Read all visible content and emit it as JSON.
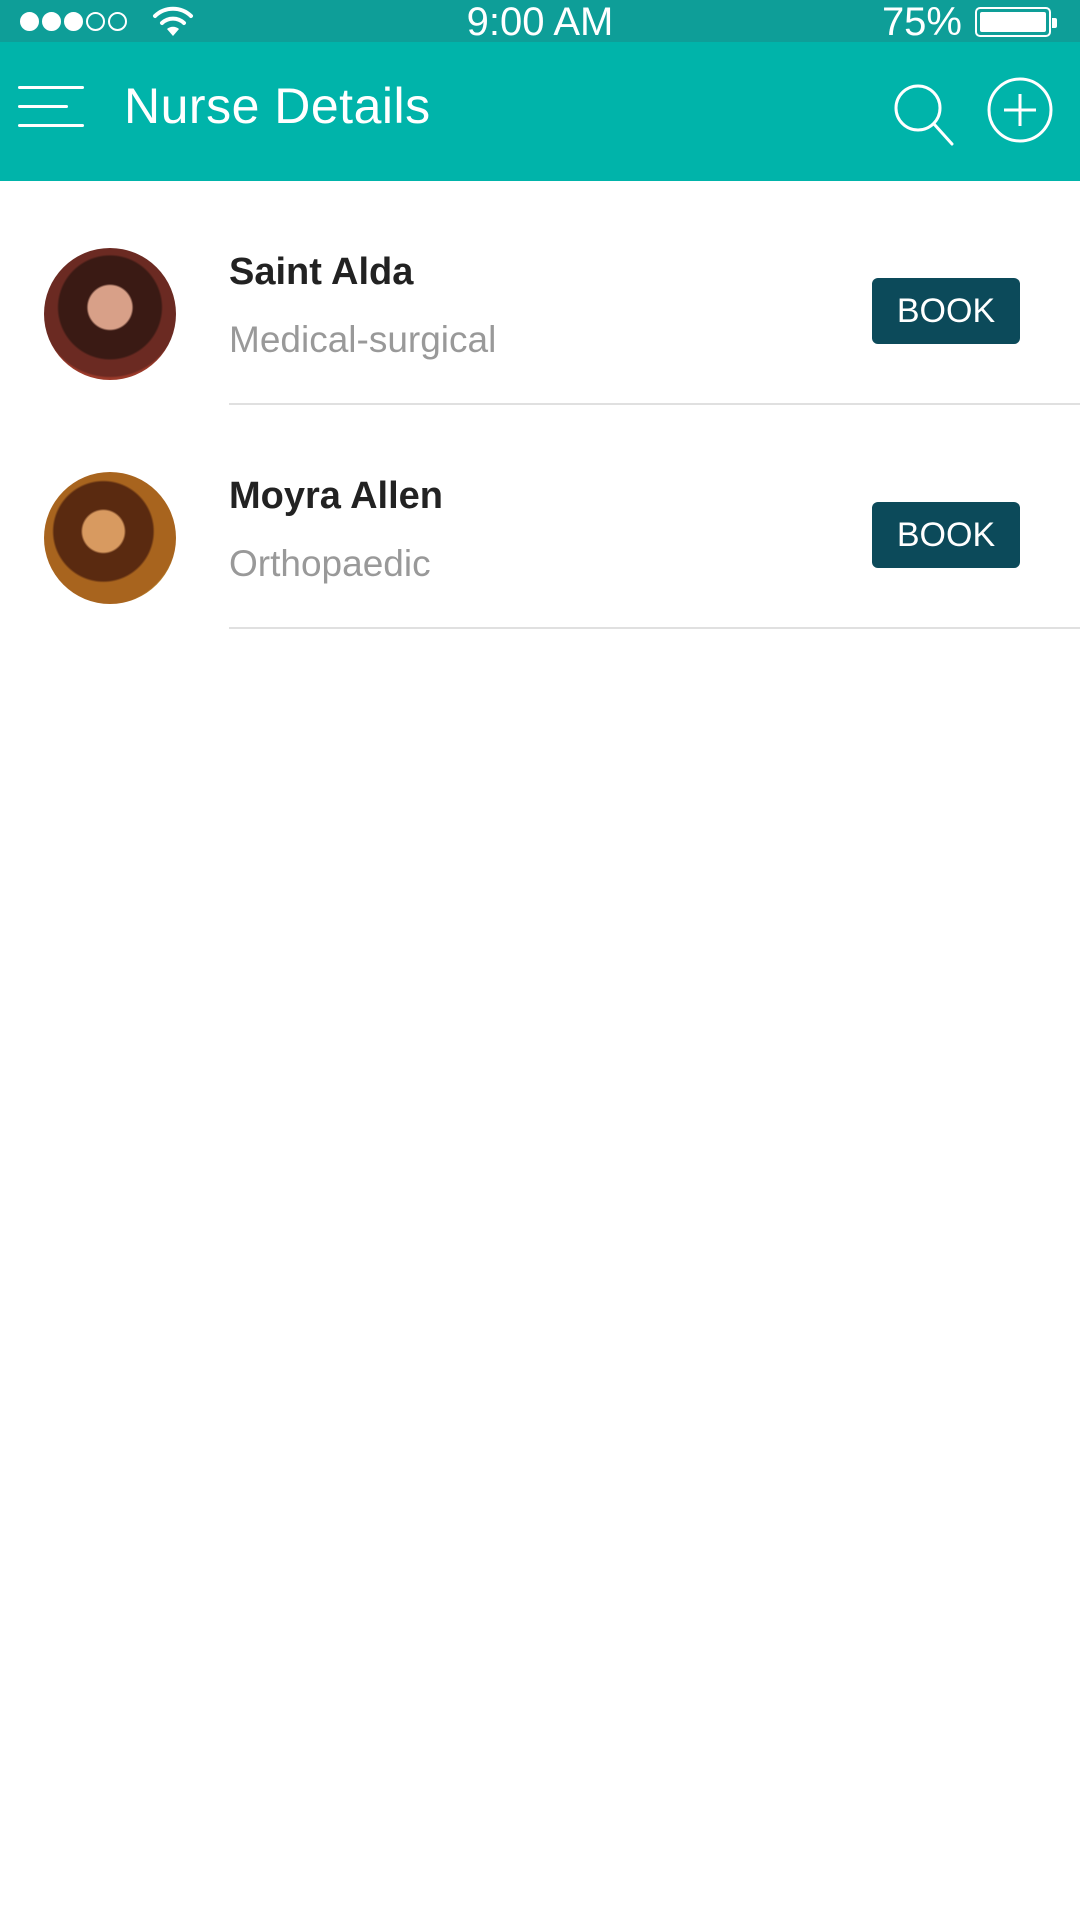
{
  "status_bar": {
    "time": "9:00 AM",
    "battery_percent": "75%",
    "signal_strength": 3,
    "signal_max": 5,
    "battery_level": 1.0,
    "color": "#0e9e98"
  },
  "nav_bar": {
    "title": "Nurse Details",
    "menu_icon": "hamburger-menu-icon",
    "search_icon": "search-icon",
    "add_icon": "add-circle-icon",
    "color": "#00b4aa"
  },
  "nurses": [
    {
      "name": "Saint Alda",
      "specialty": "Medical-surgical",
      "book_label": "BOOK"
    },
    {
      "name": "Moyra Allen",
      "specialty": "Orthopaedic",
      "book_label": "BOOK"
    }
  ],
  "colors": {
    "book_button": "#0c4a5a",
    "name_text": "#222222",
    "specialty_text": "#999999",
    "divider": "#e0e0e0"
  }
}
